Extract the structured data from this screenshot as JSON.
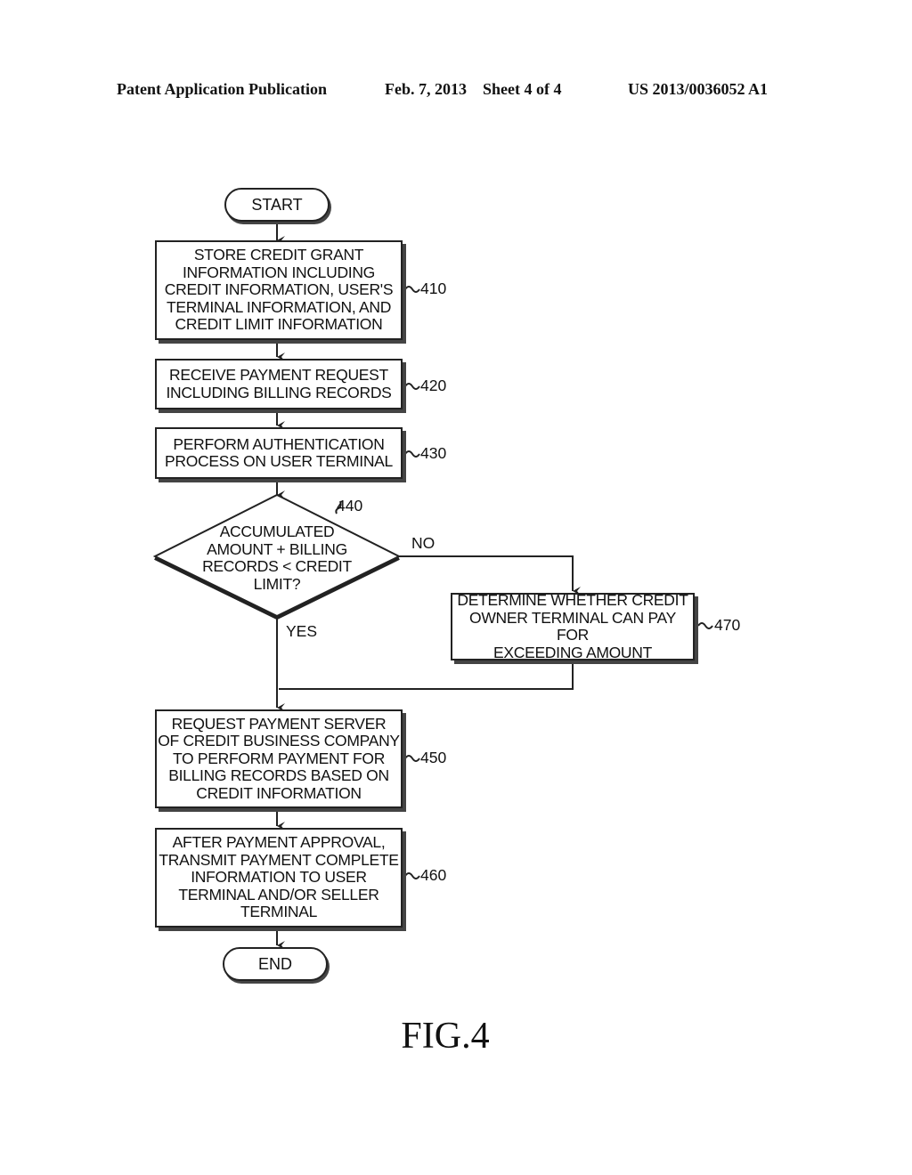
{
  "header": {
    "publication": "Patent Application Publication",
    "date_sheet": "Feb. 7, 2013    Sheet 4 of 4",
    "number": "US 2013/0036052 A1"
  },
  "flowchart": {
    "start": "START",
    "end": "END",
    "steps": [
      {
        "ref": "410",
        "text": "STORE CREDIT GRANT\nINFORMATION INCLUDING\nCREDIT INFORMATION, USER'S\nTERMINAL INFORMATION, AND\nCREDIT LIMIT INFORMATION"
      },
      {
        "ref": "420",
        "text": "RECEIVE PAYMENT REQUEST\nINCLUDING BILLING RECORDS"
      },
      {
        "ref": "430",
        "text": "PERFORM AUTHENTICATION\nPROCESS ON USER TERMINAL"
      },
      {
        "ref": "470",
        "text": "DETERMINE WHETHER CREDIT\nOWNER TERMINAL CAN PAY FOR\nEXCEEDING AMOUNT"
      },
      {
        "ref": "450",
        "text": "REQUEST PAYMENT SERVER\nOF CREDIT BUSINESS COMPANY\nTO PERFORM PAYMENT FOR\nBILLING RECORDS BASED ON\nCREDIT INFORMATION"
      },
      {
        "ref": "460",
        "text": "AFTER PAYMENT APPROVAL,\nTRANSMIT PAYMENT COMPLETE\nINFORMATION TO USER\nTERMINAL AND/OR SELLER\nTERMINAL"
      }
    ],
    "decision": {
      "ref": "440",
      "text": "ACCUMULATED\nAMOUNT + BILLING\nRECORDS < CREDIT\nLIMIT?",
      "yes": "YES",
      "no": "NO"
    }
  },
  "figure_label": "FIG.4"
}
